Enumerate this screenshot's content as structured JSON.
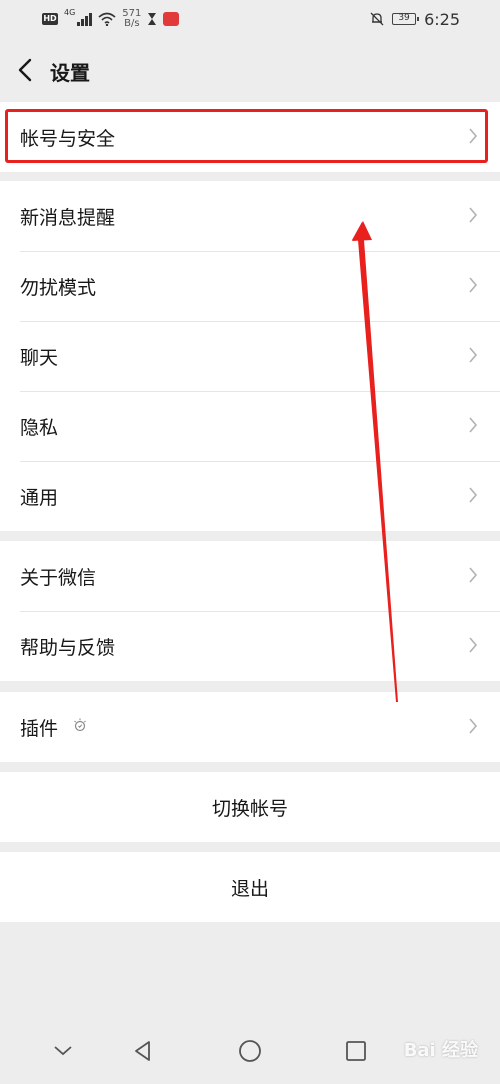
{
  "status_bar": {
    "network_badge": "HD",
    "network_type": "4G",
    "speed_value": "571",
    "speed_unit": "B/s",
    "battery": "39",
    "time": "6:25"
  },
  "header": {
    "title": "设置"
  },
  "groups": [
    {
      "items": [
        {
          "label": "帐号与安全"
        }
      ]
    },
    {
      "items": [
        {
          "label": "新消息提醒"
        },
        {
          "label": "勿扰模式"
        },
        {
          "label": "聊天"
        },
        {
          "label": "隐私"
        },
        {
          "label": "通用"
        }
      ]
    },
    {
      "items": [
        {
          "label": "关于微信"
        },
        {
          "label": "帮助与反馈"
        }
      ]
    },
    {
      "items": [
        {
          "label": "插件"
        }
      ]
    }
  ],
  "actions": {
    "switch_account": "切换帐号",
    "logout": "退出"
  },
  "watermark": "Bai 经验",
  "colors": {
    "background": "#ededed",
    "row_background": "#ffffff",
    "annotation_red": "#e8201e"
  },
  "icons": {
    "back": "chevron-left-icon",
    "row_chevron": "chevron-right-icon",
    "plugin": "plugin-bulb-icon",
    "nav_down": "chevron-down-icon",
    "nav_back": "triangle-back-icon",
    "nav_home": "circle-home-icon",
    "nav_recent": "square-recent-icon"
  }
}
